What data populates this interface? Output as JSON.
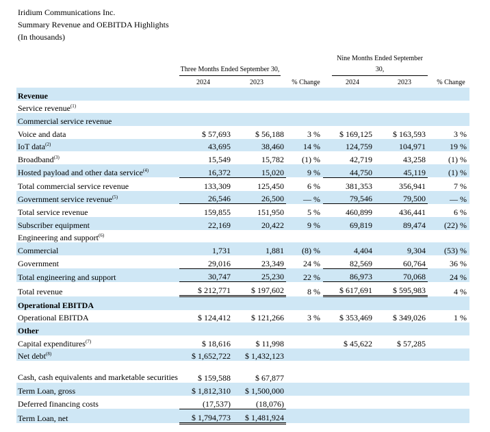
{
  "header": {
    "company": "Iridium Communications Inc.",
    "title": "Summary Revenue and OEBITDA Highlights",
    "units": "(In thousands)"
  },
  "columns": {
    "three_months_label": "Three Months Ended September 30,",
    "nine_months_label_line1": "Nine Months Ended September",
    "nine_months_label_line2": "30,",
    "years": [
      "2024",
      "2023",
      "2024",
      "2023"
    ],
    "change": "% Change"
  },
  "colors": {
    "row_shade": "#cfe7f5"
  },
  "rows": [
    {
      "label": "Revenue"
    },
    {
      "label": "Service revenue",
      "note": "(1)"
    },
    {
      "label": "Commercial service revenue"
    },
    {
      "label": "Voice and data",
      "q2024": "$ 57,693",
      "q2023": "$ 56,188",
      "qchg": "3 %",
      "n2024": "$ 169,125",
      "n2023": "$ 163,593",
      "nchg": "3 %"
    },
    {
      "label": "IoT data",
      "note": "(2)",
      "q2024": "43,695",
      "q2023": "38,460",
      "qchg": "14 %",
      "n2024": "124,759",
      "n2023": "104,971",
      "nchg": "19 %"
    },
    {
      "label": "Broadband",
      "note": "(3)",
      "q2024": "15,549",
      "q2023": "15,782",
      "qchg": "(1) %",
      "n2024": "42,719",
      "n2023": "43,258",
      "nchg": "(1) %"
    },
    {
      "label": "Hosted payload and other data service",
      "note": "(4)",
      "q2024": "16,372",
      "q2023": "15,020",
      "qchg": "9 %",
      "n2024": "44,750",
      "n2023": "45,119",
      "nchg": "(1) %"
    },
    {
      "label": "Total commercial service revenue",
      "q2024": "133,309",
      "q2023": "125,450",
      "qchg": "6 %",
      "n2024": "381,353",
      "n2023": "356,941",
      "nchg": "7 %"
    },
    {
      "label": "Government service revenue",
      "note": "(5)",
      "q2024": "26,546",
      "q2023": "26,500",
      "qchg": "— %",
      "n2024": "79,546",
      "n2023": "79,500",
      "nchg": "— %"
    },
    {
      "label": "Total service revenue",
      "q2024": "159,855",
      "q2023": "151,950",
      "qchg": "5 %",
      "n2024": "460,899",
      "n2023": "436,441",
      "nchg": "6 %"
    },
    {
      "label": "Subscriber equipment",
      "q2024": "22,169",
      "q2023": "20,422",
      "qchg": "9 %",
      "n2024": "69,819",
      "n2023": "89,474",
      "nchg": "(22) %"
    },
    {
      "label": "Engineering and support",
      "note": "(6)"
    },
    {
      "label": "Commercial",
      "q2024": "1,731",
      "q2023": "1,881",
      "qchg": "(8) %",
      "n2024": "4,404",
      "n2023": "9,304",
      "nchg": "(53) %"
    },
    {
      "label": "Government",
      "q2024": "29,016",
      "q2023": "23,349",
      "qchg": "24 %",
      "n2024": "82,569",
      "n2023": "60,764",
      "nchg": "36 %"
    },
    {
      "label": "Total engineering and support",
      "q2024": "30,747",
      "q2023": "25,230",
      "qchg": "22 %",
      "n2024": "86,973",
      "n2023": "70,068",
      "nchg": "24 %"
    },
    {
      "label": "Total revenue",
      "q2024": "$ 212,771",
      "q2023": "$ 197,602",
      "qchg": "8 %",
      "n2024": "$ 617,691",
      "n2023": "$ 595,983",
      "nchg": "4 %"
    },
    {
      "label": "Operational EBITDA"
    },
    {
      "label": "Operational EBITDA",
      "q2024": "$ 124,412",
      "q2023": "$ 121,266",
      "qchg": "3 %",
      "n2024": "$ 353,469",
      "n2023": "$ 349,026",
      "nchg": "1 %"
    },
    {
      "label": "Other"
    },
    {
      "label": "Capital expenditures",
      "note": "(7)",
      "q2024": "$ 18,616",
      "q2023": "$ 11,998",
      "n2024": "$ 45,622",
      "n2023": "$ 57,285"
    },
    {
      "label": "Net debt",
      "note": "(8)",
      "q2024": "$ 1,652,722",
      "q2023": "$ 1,432,123"
    },
    {
      "label": "Cash, cash equivalents and marketable securities",
      "q2024": "$ 159,588",
      "q2023": "$ 67,877"
    },
    {
      "label": "Term Loan, gross",
      "q2024": "$ 1,812,310",
      "q2023": "$ 1,500,000"
    },
    {
      "label": "Deferred financing costs",
      "q2024": "(17,537)",
      "q2023": "(18,076)"
    },
    {
      "label": "Term Loan, net",
      "q2024": "$ 1,794,773",
      "q2023": "$ 1,481,924"
    }
  ]
}
